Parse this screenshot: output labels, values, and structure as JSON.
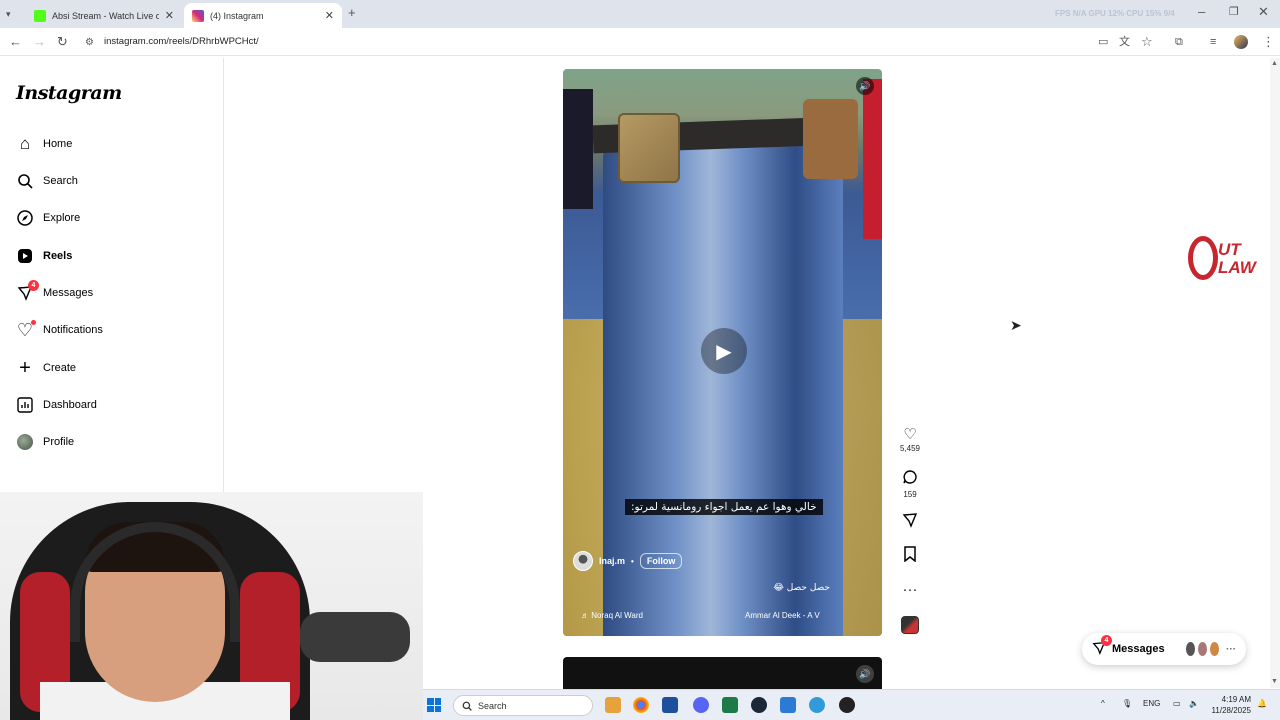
{
  "browser": {
    "tabs": [
      {
        "title": "Absi Stream - Watch Live on Ki",
        "favicon_color": "#53fc18",
        "active": false
      },
      {
        "title": "(4) Instagram",
        "favicon_color": "#d62976",
        "active": true
      }
    ],
    "new_tab": "+",
    "url": "instagram.com/reels/DRhrbWPCHct/",
    "perf": "FPS N/A   GPU 12%   CPU 15%   9/4"
  },
  "sidebar": {
    "logo": "Instagram",
    "items": [
      {
        "label": "Home",
        "icon": "home-icon",
        "glyph": "⌂"
      },
      {
        "label": "Search",
        "icon": "search-icon",
        "glyph": "⚲"
      },
      {
        "label": "Explore",
        "icon": "compass-icon",
        "glyph": "◎"
      },
      {
        "label": "Reels",
        "icon": "reels-icon",
        "glyph": "▣"
      },
      {
        "label": "Messages",
        "icon": "messenger-icon",
        "glyph": "✈",
        "badge": "4"
      },
      {
        "label": "Notifications",
        "icon": "heart-icon",
        "glyph": "♡"
      },
      {
        "label": "Create",
        "icon": "plus-icon",
        "glyph": "+"
      },
      {
        "label": "Dashboard",
        "icon": "dashboard-icon",
        "glyph": "▤"
      },
      {
        "label": "Profile",
        "icon": "profile-avatar",
        "glyph": "●"
      }
    ]
  },
  "reel": {
    "caption": "خالي وهوا عم يعمل اجواء رومانسية لمرتو:",
    "username": "lnaj.m",
    "follow": "Follow",
    "description": "حصل حصل 😂",
    "audio_left": "♬ Noraq Al Ward",
    "audio_right": "Ammar Al Deek - A V"
  },
  "actions": {
    "likes": "5,459",
    "comments": "159"
  },
  "overlay": {
    "logo_line1": "UT",
    "logo_line2": "LAW"
  },
  "messages_pill": {
    "label": "Messages",
    "badge": "4",
    "more": "···"
  },
  "taskbar": {
    "search": "Search",
    "lang": "ENG",
    "time": "4:19 AM",
    "date": "11/28/2025"
  },
  "colors": {
    "accent_red": "#ff3040",
    "outlaw_red": "#c8262e"
  }
}
